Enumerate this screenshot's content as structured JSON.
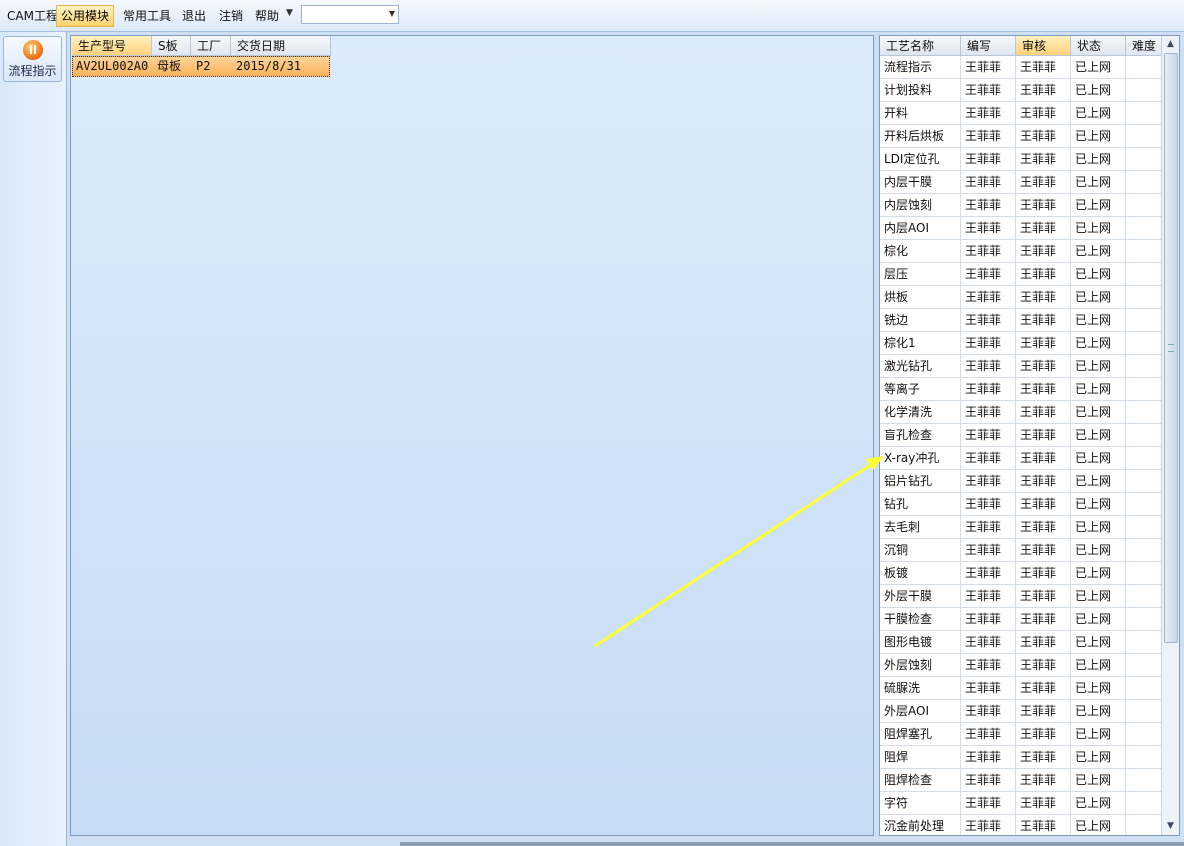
{
  "menubar": {
    "items": [
      "CAM工程",
      "公用模块",
      "常用工具",
      "退出",
      "注销",
      "帮助"
    ],
    "active": "公用模块",
    "combo_value": ""
  },
  "leftnav": {
    "flow_button_label": "流程指示",
    "flow_button_icon": "pause-circle-icon"
  },
  "order_grid": {
    "columns": [
      "生产型号",
      "S板",
      "工厂",
      "交货日期"
    ],
    "selected_column": "生产型号",
    "rows": [
      {
        "model": "AV2UL002A0",
        "board": "母板",
        "factory": "P2",
        "delivery_date": "2015/8/31"
      }
    ]
  },
  "process_grid": {
    "columns": [
      "工艺名称",
      "编写",
      "审核",
      "状态",
      "难度"
    ],
    "selected_column": "审核",
    "rows": [
      {
        "name": "流程指示",
        "author": "王菲菲",
        "reviewer": "王菲菲",
        "status": "已上网",
        "difficulty": ""
      },
      {
        "name": "计划投料",
        "author": "王菲菲",
        "reviewer": "王菲菲",
        "status": "已上网",
        "difficulty": ""
      },
      {
        "name": "开料",
        "author": "王菲菲",
        "reviewer": "王菲菲",
        "status": "已上网",
        "difficulty": ""
      },
      {
        "name": "开料后烘板",
        "author": "王菲菲",
        "reviewer": "王菲菲",
        "status": "已上网",
        "difficulty": ""
      },
      {
        "name": "LDI定位孔",
        "author": "王菲菲",
        "reviewer": "王菲菲",
        "status": "已上网",
        "difficulty": ""
      },
      {
        "name": "内层干膜",
        "author": "王菲菲",
        "reviewer": "王菲菲",
        "status": "已上网",
        "difficulty": ""
      },
      {
        "name": "内层蚀刻",
        "author": "王菲菲",
        "reviewer": "王菲菲",
        "status": "已上网",
        "difficulty": ""
      },
      {
        "name": "内层AOI",
        "author": "王菲菲",
        "reviewer": "王菲菲",
        "status": "已上网",
        "difficulty": ""
      },
      {
        "name": "棕化",
        "author": "王菲菲",
        "reviewer": "王菲菲",
        "status": "已上网",
        "difficulty": ""
      },
      {
        "name": "层压",
        "author": "王菲菲",
        "reviewer": "王菲菲",
        "status": "已上网",
        "difficulty": ""
      },
      {
        "name": "烘板",
        "author": "王菲菲",
        "reviewer": "王菲菲",
        "status": "已上网",
        "difficulty": ""
      },
      {
        "name": "铣边",
        "author": "王菲菲",
        "reviewer": "王菲菲",
        "status": "已上网",
        "difficulty": ""
      },
      {
        "name": "棕化1",
        "author": "王菲菲",
        "reviewer": "王菲菲",
        "status": "已上网",
        "difficulty": ""
      },
      {
        "name": "激光钻孔",
        "author": "王菲菲",
        "reviewer": "王菲菲",
        "status": "已上网",
        "difficulty": ""
      },
      {
        "name": "等离子",
        "author": "王菲菲",
        "reviewer": "王菲菲",
        "status": "已上网",
        "difficulty": ""
      },
      {
        "name": "化学清洗",
        "author": "王菲菲",
        "reviewer": "王菲菲",
        "status": "已上网",
        "difficulty": ""
      },
      {
        "name": "盲孔检查",
        "author": "王菲菲",
        "reviewer": "王菲菲",
        "status": "已上网",
        "difficulty": ""
      },
      {
        "name": "X-ray冲孔",
        "author": "王菲菲",
        "reviewer": "王菲菲",
        "status": "已上网",
        "difficulty": ""
      },
      {
        "name": "铝片钻孔",
        "author": "王菲菲",
        "reviewer": "王菲菲",
        "status": "已上网",
        "difficulty": ""
      },
      {
        "name": "钻孔",
        "author": "王菲菲",
        "reviewer": "王菲菲",
        "status": "已上网",
        "difficulty": ""
      },
      {
        "name": "去毛刺",
        "author": "王菲菲",
        "reviewer": "王菲菲",
        "status": "已上网",
        "difficulty": ""
      },
      {
        "name": "沉铜",
        "author": "王菲菲",
        "reviewer": "王菲菲",
        "status": "已上网",
        "difficulty": ""
      },
      {
        "name": "板镀",
        "author": "王菲菲",
        "reviewer": "王菲菲",
        "status": "已上网",
        "difficulty": ""
      },
      {
        "name": "外层干膜",
        "author": "王菲菲",
        "reviewer": "王菲菲",
        "status": "已上网",
        "difficulty": ""
      },
      {
        "name": "干膜检查",
        "author": "王菲菲",
        "reviewer": "王菲菲",
        "status": "已上网",
        "difficulty": ""
      },
      {
        "name": "图形电镀",
        "author": "王菲菲",
        "reviewer": "王菲菲",
        "status": "已上网",
        "difficulty": ""
      },
      {
        "name": "外层蚀刻",
        "author": "王菲菲",
        "reviewer": "王菲菲",
        "status": "已上网",
        "difficulty": ""
      },
      {
        "name": "硫脲洗",
        "author": "王菲菲",
        "reviewer": "王菲菲",
        "status": "已上网",
        "difficulty": ""
      },
      {
        "name": "外层AOI",
        "author": "王菲菲",
        "reviewer": "王菲菲",
        "status": "已上网",
        "difficulty": ""
      },
      {
        "name": "阻焊塞孔",
        "author": "王菲菲",
        "reviewer": "王菲菲",
        "status": "已上网",
        "difficulty": ""
      },
      {
        "name": "阻焊",
        "author": "王菲菲",
        "reviewer": "王菲菲",
        "status": "已上网",
        "difficulty": ""
      },
      {
        "name": "阻焊检查",
        "author": "王菲菲",
        "reviewer": "王菲菲",
        "status": "已上网",
        "difficulty": ""
      },
      {
        "name": "字符",
        "author": "王菲菲",
        "reviewer": "王菲菲",
        "status": "已上网",
        "difficulty": ""
      },
      {
        "name": "沉金前处理",
        "author": "王菲菲",
        "reviewer": "王菲菲",
        "status": "已上网",
        "difficulty": ""
      }
    ]
  },
  "annotation": {
    "arrow_color": "#ffff33",
    "arrow_target": "X-ray冲孔"
  }
}
